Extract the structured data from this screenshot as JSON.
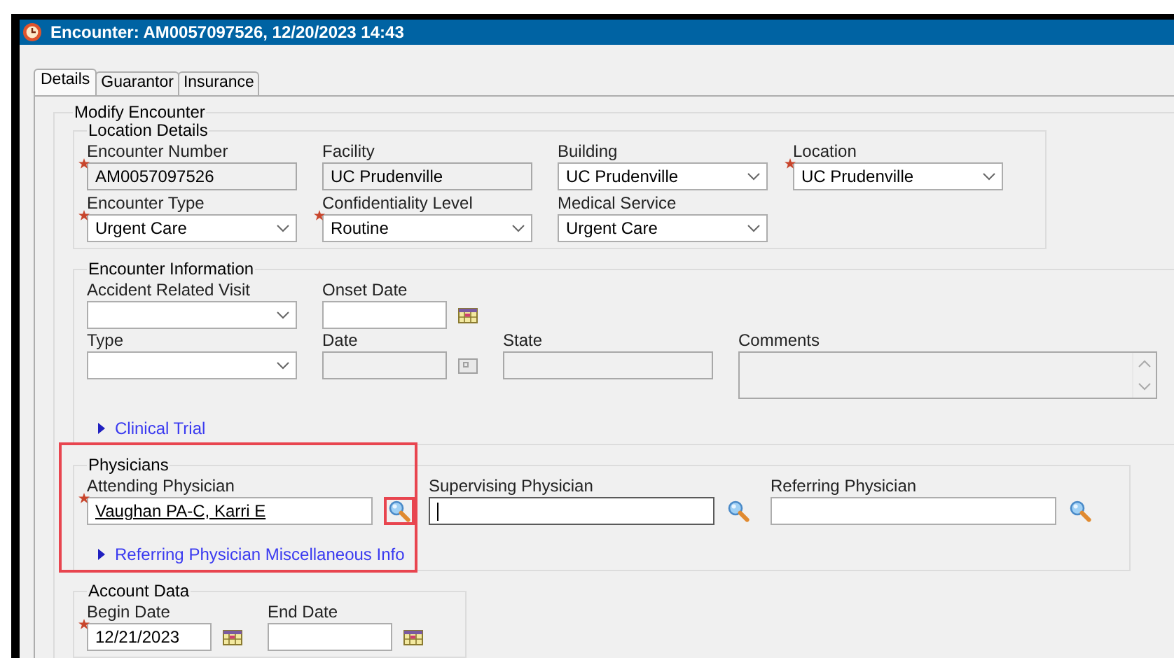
{
  "window": {
    "title": "Encounter: AM0057097526, 12/20/2023 14:43"
  },
  "tabs": [
    {
      "label": "Details",
      "selected": true
    },
    {
      "label": "Guarantor",
      "selected": false
    },
    {
      "label": "Insurance",
      "selected": false
    }
  ],
  "form": {
    "title": "Modify Encounter",
    "sections": [
      {
        "title": "Location Details",
        "highlighted": false,
        "rows": [
          [
            {
              "kind": "text",
              "label": "Encounter Number",
              "value": "AM0057097526",
              "required": true,
              "disabled": true
            },
            {
              "kind": "text",
              "label": "Facility",
              "value": "UC Prudenville",
              "required": false,
              "disabled": true
            },
            {
              "kind": "dropdown",
              "label": "Building",
              "value": "UC Prudenville",
              "required": false,
              "disabled": false
            },
            {
              "kind": "dropdown",
              "label": "Location",
              "value": "UC Prudenville",
              "required": true,
              "disabled": false
            }
          ],
          [
            {
              "kind": "dropdown",
              "label": "Encounter Type",
              "value": "Urgent Care",
              "required": true,
              "disabled": false
            },
            {
              "kind": "dropdown",
              "label": "Confidentiality Level",
              "value": "Routine",
              "required": true,
              "disabled": false
            },
            {
              "kind": "dropdown",
              "label": "Medical Service",
              "value": "Urgent Care",
              "required": false,
              "disabled": false
            }
          ]
        ]
      },
      {
        "title": "Encounter Information",
        "highlighted": false,
        "rows": [
          [
            {
              "kind": "dropdown",
              "label": "Accident Related Visit",
              "required": false,
              "disabled": false
            },
            {
              "kind": "date",
              "label": "Onset Date",
              "required": false,
              "disabled": false
            }
          ],
          [
            {
              "kind": "dropdown",
              "label": "Type",
              "required": false,
              "disabled": false
            },
            {
              "kind": "date",
              "label": "Date",
              "required": false,
              "disabled": true
            },
            {
              "kind": "text",
              "label": "State",
              "required": false,
              "disabled": true
            },
            {
              "kind": "textarea",
              "label": "Comments",
              "required": false,
              "disabled": true
            }
          ]
        ],
        "links": [
          {
            "label": "Clinical Trial",
            "expanded": false
          }
        ]
      },
      {
        "title": "Physicians",
        "highlighted": true,
        "rows": [
          [
            {
              "kind": "lookup",
              "label": "Attending Physician",
              "value": "Vaughan PA-C, Karri E",
              "required": true,
              "disabled": false,
              "focused": false,
              "highlighted": true
            },
            {
              "kind": "lookup",
              "label": "Supervising Physician",
              "required": false,
              "disabled": false,
              "focused": true,
              "highlighted": false
            },
            {
              "kind": "lookup",
              "label": "Referring Physician",
              "required": false,
              "disabled": false,
              "focused": false,
              "highlighted": false
            }
          ]
        ],
        "links": [
          {
            "label": "Referring Physician Miscellaneous Info",
            "expanded": false
          }
        ]
      },
      {
        "title": "Account Data",
        "highlighted": false,
        "rows": [
          [
            {
              "kind": "date",
              "label": "Begin Date",
              "value": "12/21/2023",
              "required": true,
              "disabled": false
            },
            {
              "kind": "date",
              "label": "End Date",
              "required": false,
              "disabled": false
            }
          ]
        ]
      }
    ]
  }
}
